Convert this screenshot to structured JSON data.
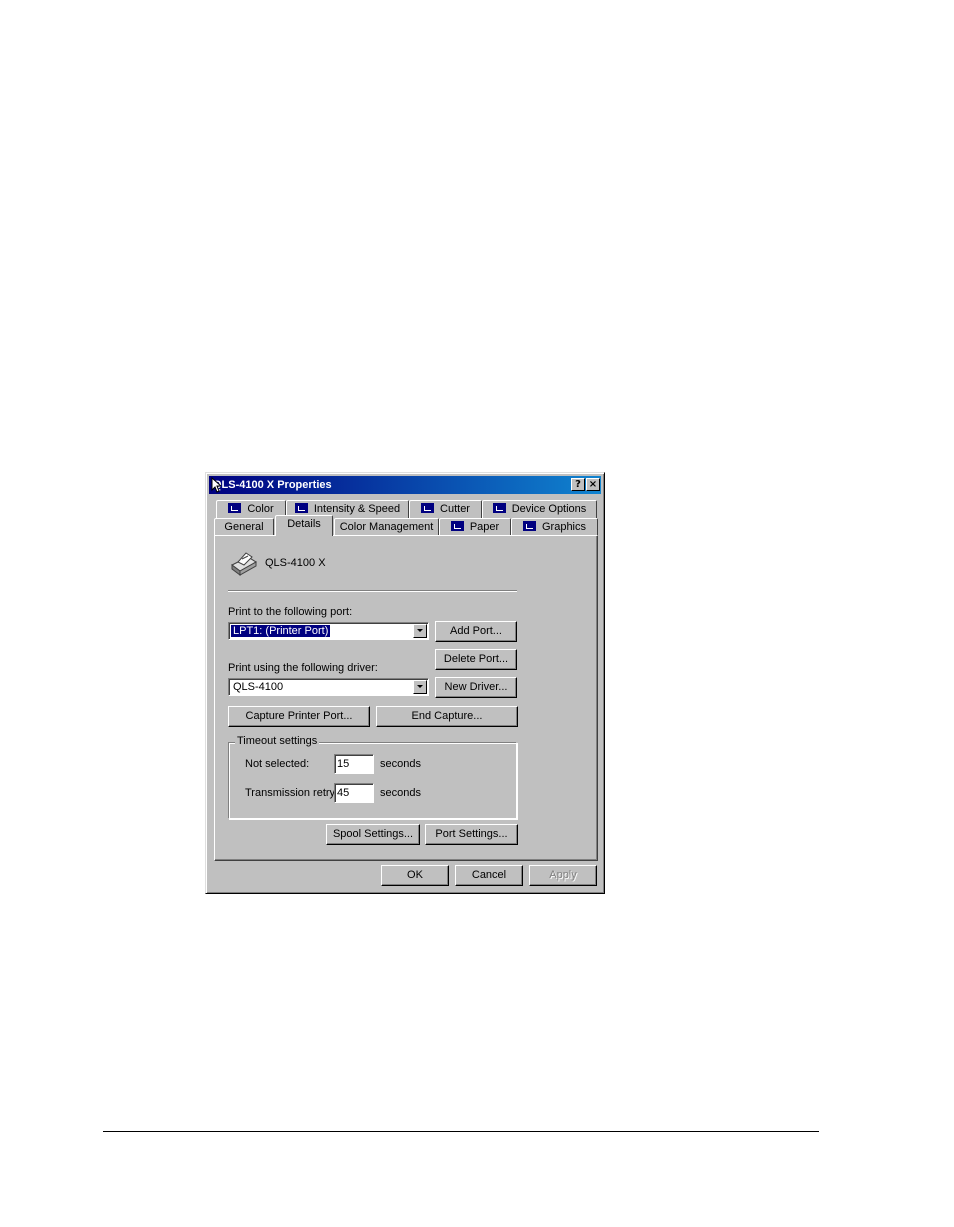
{
  "window": {
    "title": "QLS-4100 X Properties",
    "help_button": "?",
    "close_button": "×"
  },
  "tabs": {
    "row_back": [
      {
        "label": "Color"
      },
      {
        "label": "Intensity & Speed"
      },
      {
        "label": "Cutter"
      },
      {
        "label": "Device Options"
      }
    ],
    "row_front": [
      {
        "label": "General"
      },
      {
        "label": "Details"
      },
      {
        "label": "Color Management"
      },
      {
        "label": "Paper"
      },
      {
        "label": "Graphics"
      }
    ],
    "active": "Details"
  },
  "details": {
    "printer_name": "QLS-4100 X",
    "port_label": "Print to the following port:",
    "port_value": "LPT1:  (Printer Port)",
    "add_port": "Add Port...",
    "delete_port": "Delete Port...",
    "driver_label": "Print using the following driver:",
    "driver_value": "QLS-4100",
    "new_driver": "New Driver...",
    "capture_port": "Capture Printer Port...",
    "end_capture": "End Capture...",
    "timeout": {
      "title": "Timeout settings",
      "not_selected_label": "Not selected:",
      "not_selected_value": "15",
      "retry_label": "Transmission retry:",
      "retry_value": "45",
      "unit": "seconds"
    },
    "spool_settings": "Spool Settings...",
    "port_settings": "Port Settings..."
  },
  "footer": {
    "ok": "OK",
    "cancel": "Cancel",
    "apply": "Apply"
  },
  "icons": [
    "printer-icon",
    "tab-page-icon",
    "help-icon",
    "close-icon",
    "dropdown-arrow-icon",
    "mouse-cursor-icon"
  ]
}
